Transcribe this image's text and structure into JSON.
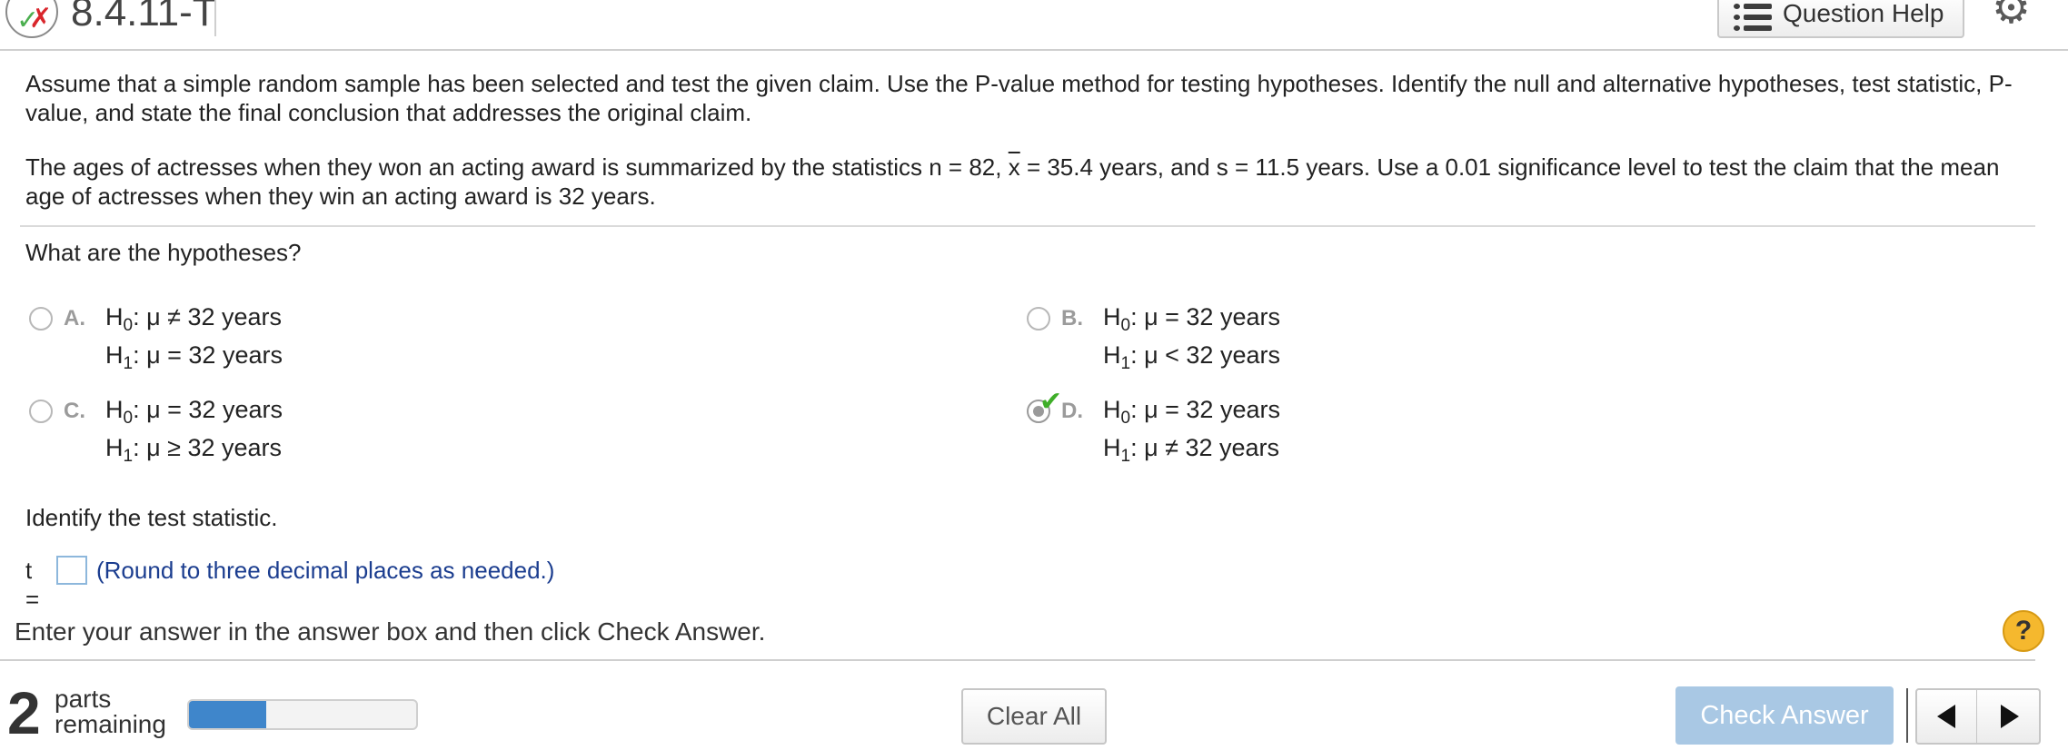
{
  "header": {
    "question_id": "8.4.11-T",
    "help_label": "Question Help",
    "status_check_glyph": "✓",
    "status_x_glyph": "✗",
    "gear_glyph": "⚙",
    "status_icon": "partial-correct-icon"
  },
  "problem": {
    "instructions": "Assume that a simple random sample has been selected and test the given claim. Use the P-value method for testing hypotheses. Identify the null and alternative hypotheses, test statistic, P-value, and state the final conclusion that addresses the original claim.",
    "scenario_before": "The ages of actresses when they won an acting award is summarized by the statistics n = 82, ",
    "xbar_symbol": "x",
    "scenario_after": " = 35.4 years, and s = 11.5 years. Use a 0.01 significance level to test the claim that the mean age of actresses when they win an acting award is 32 years.",
    "question_hypotheses": "What are the hypotheses?",
    "question_statistic": "Identify the test statistic."
  },
  "options": [
    {
      "letter": "A.",
      "h0_prefix": "H",
      "h0_sub": "0",
      "h0_rest": ": μ ≠ 32 years",
      "h1_prefix": "H",
      "h1_sub": "1",
      "h1_rest": ": μ = 32 years",
      "selected": false
    },
    {
      "letter": "B.",
      "h0_prefix": "H",
      "h0_sub": "0",
      "h0_rest": ": μ = 32 years",
      "h1_prefix": "H",
      "h1_sub": "1",
      "h1_rest": ": μ < 32 years",
      "selected": false
    },
    {
      "letter": "C.",
      "h0_prefix": "H",
      "h0_sub": "0",
      "h0_rest": ": μ = 32 years",
      "h1_prefix": "H",
      "h1_sub": "1",
      "h1_rest": ": μ ≥ 32 years",
      "selected": false
    },
    {
      "letter": "D.",
      "h0_prefix": "H",
      "h0_sub": "0",
      "h0_rest": ": μ = 32 years",
      "h1_prefix": "H",
      "h1_sub": "1",
      "h1_rest": ": μ ≠ 32 years",
      "selected": true,
      "correct_glyph": "✔"
    }
  ],
  "answer": {
    "label": "t =",
    "value": "",
    "hint": "(Round to three decimal places as needed.)"
  },
  "footer": {
    "instruction": "Enter your answer in the answer box and then click Check Answer.",
    "help_glyph": "?",
    "parts_count": "2",
    "parts_label_1": "parts",
    "parts_label_2": "remaining",
    "progress_fraction": 0.34,
    "clear_label": "Clear All",
    "check_label": "Check Answer",
    "colors": {
      "accent": "#3f86cb",
      "check_button": "#a9c8e4",
      "correct": "#3fae29",
      "wrong": "#d9262c",
      "help": "#f5b82e"
    }
  }
}
